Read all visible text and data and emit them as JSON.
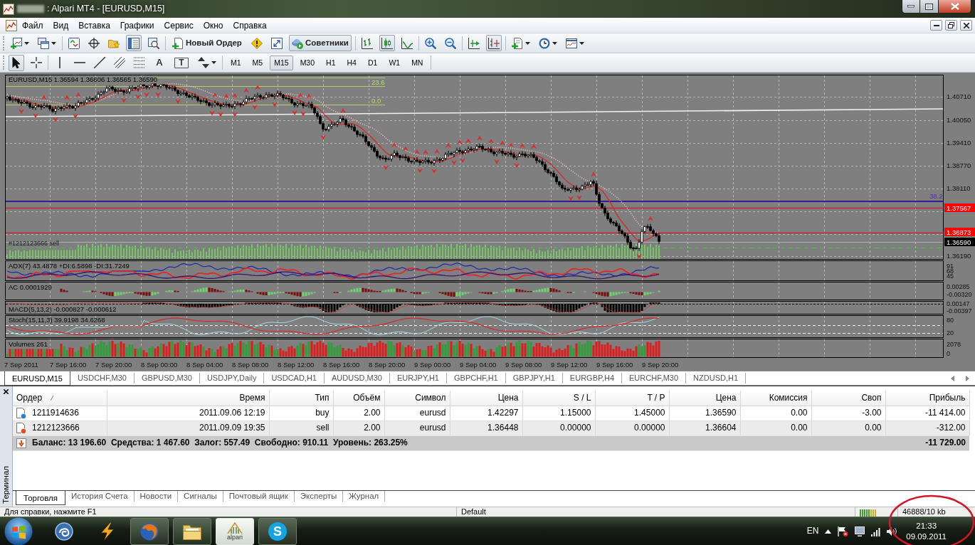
{
  "window": {
    "title": ": Alpari MT4 - [EURUSD,M15]"
  },
  "menu": [
    "Файл",
    "Вид",
    "Вставка",
    "Графики",
    "Сервис",
    "Окно",
    "Справка"
  ],
  "toolbar": [
    {
      "buttons": [
        {
          "kind": "newchart",
          "pressed": false,
          "dropdown": true
        },
        {
          "kind": "profiles",
          "pressed": false,
          "dropdown": true
        }
      ]
    },
    {
      "buttons": [
        {
          "kind": "watch",
          "pressed": false,
          "dropdown": false
        },
        {
          "kind": "navigator",
          "pressed": false,
          "dropdown": false
        },
        {
          "kind": "favorites",
          "pressed": false,
          "dropdown": false
        },
        {
          "kind": "terminal",
          "pressed": true,
          "dropdown": false
        },
        {
          "kind": "tester",
          "pressed": false,
          "dropdown": false
        }
      ]
    },
    {
      "buttons": [
        {
          "kind": "order",
          "label": "Новый Ордер",
          "pressed": false,
          "dropdown": false
        },
        {
          "kind": "autotrade",
          "pressed": false,
          "dropdown": false
        },
        {
          "kind": "expand",
          "pressed": false,
          "dropdown": false
        },
        {
          "kind": "experts",
          "label": "Советники",
          "pressed": true,
          "dropdown": false
        }
      ]
    },
    {
      "buttons": [
        {
          "kind": "bars",
          "pressed": false,
          "dropdown": false
        },
        {
          "kind": "candles",
          "pressed": true,
          "dropdown": false
        },
        {
          "kind": "line",
          "pressed": false,
          "dropdown": false
        }
      ]
    },
    {
      "buttons": [
        {
          "kind": "zoomin",
          "pressed": false,
          "dropdown": false
        },
        {
          "kind": "zoomout",
          "pressed": false,
          "dropdown": false
        }
      ]
    },
    {
      "buttons": [
        {
          "kind": "autoscroll",
          "pressed": false,
          "dropdown": false
        },
        {
          "kind": "shift",
          "pressed": true,
          "dropdown": false
        }
      ]
    },
    {
      "buttons": [
        {
          "kind": "indicators",
          "pressed": false,
          "dropdown": true
        },
        {
          "kind": "periods",
          "pressed": false,
          "dropdown": true
        },
        {
          "kind": "templates",
          "pressed": false,
          "dropdown": true
        }
      ]
    }
  ],
  "tools": [
    {
      "buttons": [
        {
          "kind": "cursor",
          "pressed": true,
          "dropdown": false
        },
        {
          "kind": "crosshair",
          "pressed": false,
          "dropdown": false
        }
      ]
    },
    {
      "buttons": [
        {
          "kind": "vline",
          "pressed": false,
          "dropdown": false
        },
        {
          "kind": "hline",
          "pressed": false,
          "dropdown": false
        },
        {
          "kind": "trend",
          "pressed": false,
          "dropdown": false
        },
        {
          "kind": "channel",
          "pressed": false,
          "dropdown": false
        },
        {
          "kind": "fibo",
          "pressed": false,
          "dropdown": false
        },
        {
          "kind": "text",
          "label": "A",
          "pressed": false,
          "dropdown": false
        },
        {
          "kind": "label",
          "label": "T",
          "pressed": false,
          "dropdown": false
        },
        {
          "kind": "arrows",
          "pressed": false,
          "dropdown": true
        }
      ]
    }
  ],
  "periods": [
    {
      "label": "M1",
      "selected": false
    },
    {
      "label": "M5",
      "selected": false
    },
    {
      "label": "M15",
      "selected": true
    },
    {
      "label": "M30",
      "selected": false
    },
    {
      "label": "H1",
      "selected": false
    },
    {
      "label": "H4",
      "selected": false
    },
    {
      "label": "D1",
      "selected": false
    },
    {
      "label": "W1",
      "selected": false
    },
    {
      "label": "MN",
      "selected": false
    }
  ],
  "chart": {
    "legend": "EURUSD,M15 1.36594 1.36606 1.36565 1.36590",
    "fibo_labels": [
      "23.6",
      "0.0"
    ],
    "level_label": "38.2",
    "order_label": "#1212123666 sell",
    "price_scale": [
      "1.40710",
      "1.40050",
      "1.39410",
      "1.38770",
      "1.38110",
      "1.36190"
    ],
    "price_tags": [
      {
        "text": "1.37567",
        "color": "#ff0000"
      },
      {
        "text": "1.36873",
        "color": "#ff0000"
      },
      {
        "text": "1.36590",
        "color": "#000000"
      }
    ],
    "indicators": [
      {
        "kind": "adx",
        "legend": "ADX(7) 43.4878 +DI:6.5898 -DI:31.7249",
        "scale": [
          "91",
          "68",
          "45"
        ]
      },
      {
        "kind": "ac",
        "legend": "AC 0.0001929",
        "scale": [
          "0.00285",
          "-0.00320"
        ]
      },
      {
        "kind": "macd",
        "legend": "MACD(5,13,2) -0.000827 -0.000612",
        "scale": [
          "0.00147",
          "-0.00397"
        ]
      },
      {
        "kind": "stoch",
        "legend": "Stoch(15,11,3) 39.9198 34.6268",
        "scale": [
          "80",
          "20"
        ]
      },
      {
        "kind": "volumes",
        "legend": "Volumes 261",
        "scale": [
          "2078",
          "0"
        ]
      }
    ],
    "time_scale": [
      "7 Sep 2011",
      "7 Sep 16:00",
      "7 Sep 20:00",
      "8 Sep 00:00",
      "8 Sep 04:00",
      "8 Sep 08:00",
      "8 Sep 12:00",
      "8 Sep 16:00",
      "8 Sep 20:00",
      "9 Sep 00:00",
      "9 Sep 04:00",
      "9 Sep 08:00",
      "9 Sep 12:00",
      "9 Sep 16:00",
      "9 Sep 20:00"
    ]
  },
  "chart_tabs": [
    {
      "label": "EURUSD,M15",
      "selected": true
    },
    {
      "label": "USDCHF,M30",
      "selected": false
    },
    {
      "label": "GBPUSD,M30",
      "selected": false
    },
    {
      "label": "USDJPY,Daily",
      "selected": false
    },
    {
      "label": "USDCAD,H1",
      "selected": false
    },
    {
      "label": "AUDUSD,M30",
      "selected": false
    },
    {
      "label": "EURJPY,H1",
      "selected": false
    },
    {
      "label": "GBPCHF,H1",
      "selected": false
    },
    {
      "label": "GBPJPY,H1",
      "selected": false
    },
    {
      "label": "EURGBP,H4",
      "selected": false
    },
    {
      "label": "EURCHF,M30",
      "selected": false
    },
    {
      "label": "NZDUSD,H1",
      "selected": false
    }
  ],
  "terminal": {
    "title": "Терминал",
    "columns": [
      "Ордер",
      "Время",
      "Тип",
      "Объём",
      "Символ",
      "Цена",
      "S / L",
      "T / P",
      "Цена",
      "Комиссия",
      "Своп",
      "Прибыль"
    ],
    "rows": [
      {
        "kind": "buy",
        "cells": [
          "1211914636",
          "2011.09.06 12:19",
          "buy",
          "2.00",
          "eurusd",
          "1.42297",
          "1.15000",
          "1.45000",
          "1.36590",
          "0.00",
          "-3.00",
          "-11 414.00"
        ]
      },
      {
        "kind": "sell",
        "cells": [
          "1212123666",
          "2011.09.09 19:35",
          "sell",
          "2.00",
          "eurusd",
          "1.36448",
          "0.00000",
          "0.00000",
          "1.36604",
          "0.00",
          "0.00",
          "-312.00"
        ]
      }
    ],
    "summary": {
      "text": "Баланс: 13 196.60  Средства: 1 467.60  Залог: 557.49  Свободно: 910.11  Уровень: 263.25%",
      "profit": "-11 729.00"
    },
    "tabs": [
      {
        "label": "Торговля",
        "selected": true
      },
      {
        "label": "История Счета",
        "selected": false
      },
      {
        "label": "Новости",
        "selected": false
      },
      {
        "label": "Сигналы",
        "selected": false
      },
      {
        "label": "Почтовый ящик",
        "selected": false
      },
      {
        "label": "Эксперты",
        "selected": false
      },
      {
        "label": "Журнал",
        "selected": false
      }
    ]
  },
  "status_bar": {
    "help": "Для справки, нажмите F1",
    "profile": "Default",
    "traffic": "46888/10 kb"
  },
  "taskbar": {
    "apps": [
      {
        "kind": "swirl",
        "running": false,
        "selected": false
      },
      {
        "kind": "bolt",
        "running": false,
        "selected": false
      },
      {
        "kind": "browser",
        "running": true,
        "selected": false
      },
      {
        "kind": "folder",
        "running": true,
        "selected": false
      },
      {
        "kind": "alpari",
        "label": "alpari",
        "running": true,
        "selected": true
      },
      {
        "kind": "skype",
        "label": "S",
        "running": true,
        "selected": false
      }
    ],
    "language": "EN",
    "time": "21:33",
    "date": "09.09.2011"
  },
  "annotations": [
    {
      "kind": "ellipse"
    }
  ]
}
